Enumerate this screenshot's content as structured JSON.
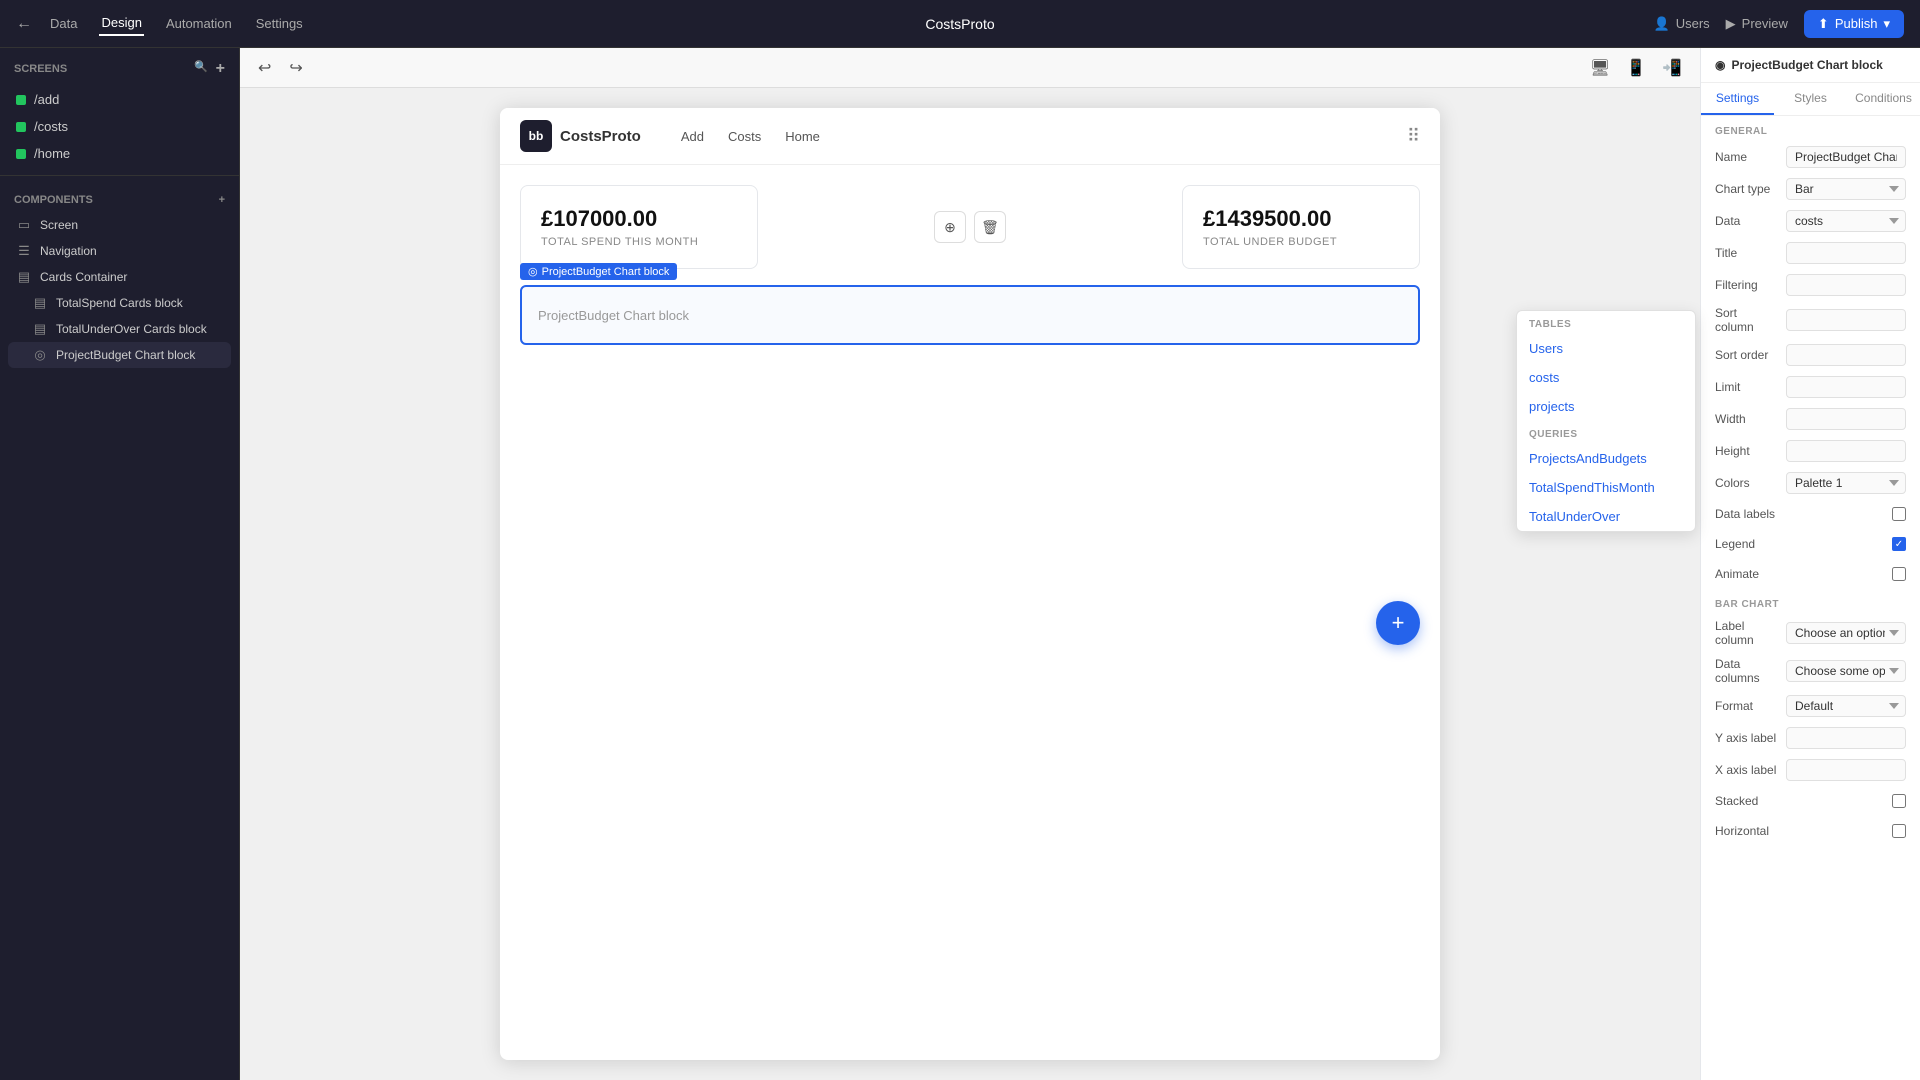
{
  "topNav": {
    "backLabel": "←",
    "tabs": [
      {
        "id": "data",
        "label": "Data",
        "active": false
      },
      {
        "id": "design",
        "label": "Design",
        "active": true
      },
      {
        "id": "automation",
        "label": "Automation",
        "active": false
      },
      {
        "id": "settings",
        "label": "Settings",
        "active": false
      }
    ],
    "appTitle": "CostsProto",
    "rightItems": [
      {
        "id": "users",
        "label": "Users",
        "icon": "👤"
      },
      {
        "id": "preview",
        "label": "Preview",
        "icon": "▶"
      },
      {
        "id": "publish",
        "label": "Publish",
        "icon": "⬆"
      }
    ]
  },
  "leftSidebar": {
    "screensLabel": "Screens",
    "screens": [
      {
        "id": "add",
        "label": "/add",
        "color": "green"
      },
      {
        "id": "costs",
        "label": "/costs",
        "color": "green"
      },
      {
        "id": "home",
        "label": "/home",
        "color": "green"
      }
    ],
    "componentsLabel": "Components",
    "components": [
      {
        "id": "screen",
        "label": "Screen",
        "icon": "▭"
      },
      {
        "id": "navigation",
        "label": "Navigation",
        "icon": "☰"
      },
      {
        "id": "cards-container",
        "label": "Cards Container",
        "icon": "▤"
      },
      {
        "id": "totalspend-cards",
        "label": "TotalSpend Cards block",
        "icon": "▤",
        "indented": true
      },
      {
        "id": "totalunder-cards",
        "label": "TotalUnderOver Cards block",
        "icon": "▤",
        "indented": true
      },
      {
        "id": "projectbudget-chart",
        "label": "ProjectBudget Chart block",
        "icon": "◎",
        "active": true,
        "indented": true
      }
    ]
  },
  "canvas": {
    "pageTitle": "CostsProto",
    "navLinks": [
      "Add",
      "Costs",
      "Home"
    ],
    "cards": [
      {
        "amount": "£107000.00",
        "label": "TOTAL SPEND THIS MONTH"
      },
      {
        "amount": "£1439500.00",
        "label": "TOTAL UNDER BUDGET"
      }
    ],
    "chartBlock": {
      "label": "ProjectBudget Chart block",
      "placeholder": "ProjectBudget Chart block"
    },
    "fabIcon": "+"
  },
  "rightPanel": {
    "headerIcon": "◉",
    "headerTitle": "ProjectBudget Chart block",
    "tabs": [
      "Settings",
      "Styles",
      "Conditions"
    ],
    "generalLabel": "GENERAL",
    "fields": {
      "name": {
        "label": "Name",
        "value": "ProjectBudget Chart b..."
      },
      "chartType": {
        "label": "Chart type",
        "value": "Bar"
      },
      "data": {
        "label": "Data",
        "value": "costs"
      },
      "title": {
        "label": "Title",
        "value": ""
      },
      "filtering": {
        "label": "Filtering",
        "value": ""
      },
      "sortColumn": {
        "label": "Sort column",
        "value": ""
      },
      "sortOrder": {
        "label": "Sort order",
        "value": ""
      },
      "limit": {
        "label": "Limit",
        "value": ""
      },
      "width": {
        "label": "Width",
        "value": ""
      },
      "height": {
        "label": "Height",
        "value": ""
      },
      "colors": {
        "label": "Colors",
        "value": "Palette 1"
      },
      "dataLabels": {
        "label": "Data labels",
        "checked": false
      },
      "legend": {
        "label": "Legend",
        "checked": true
      },
      "animate": {
        "label": "Animate",
        "checked": false
      }
    },
    "barChartLabel": "BAR CHART",
    "barChartFields": {
      "labelColumn": {
        "label": "Label column",
        "value": "Choose an option"
      },
      "dataColumns": {
        "label": "Data columns",
        "value": "Choose some opti..."
      },
      "format": {
        "label": "Format",
        "value": "Default"
      },
      "yAxisLabel": {
        "label": "Y axis label",
        "value": ""
      },
      "xAxisLabel": {
        "label": "X axis label",
        "value": ""
      },
      "stacked": {
        "label": "Stacked",
        "checked": false
      },
      "horizontal": {
        "label": "Horizontal",
        "checked": false
      }
    }
  },
  "dropdown": {
    "tablesLabel": "Tables",
    "tables": [
      "Users",
      "costs",
      "projects"
    ],
    "queriesLabel": "Queries",
    "queries": [
      "ProjectsAndBudgets",
      "TotalSpendThisMonth",
      "TotalUnderOver"
    ]
  }
}
